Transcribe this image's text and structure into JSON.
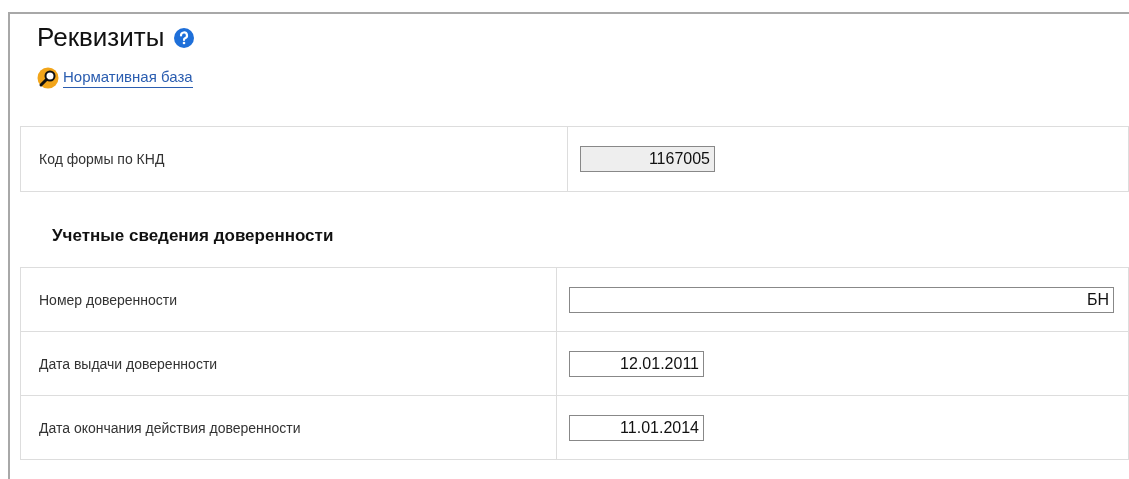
{
  "title": "Реквизиты",
  "link": "Нормативная база",
  "form_code": {
    "label": "Код формы по КНД",
    "value": "1167005",
    "disabled": true
  },
  "section": {
    "heading": "Учетные сведения доверенности",
    "rows": [
      {
        "label": "Номер доверенности",
        "value": "БН",
        "disabled": false,
        "kind": "wide"
      },
      {
        "label": "Дата выдачи доверенности",
        "value": "12.01.2011",
        "disabled": false,
        "kind": "short"
      },
      {
        "label": "Дата окончания действия доверенности",
        "value": "11.01.2014",
        "disabled": false,
        "kind": "short"
      }
    ]
  }
}
